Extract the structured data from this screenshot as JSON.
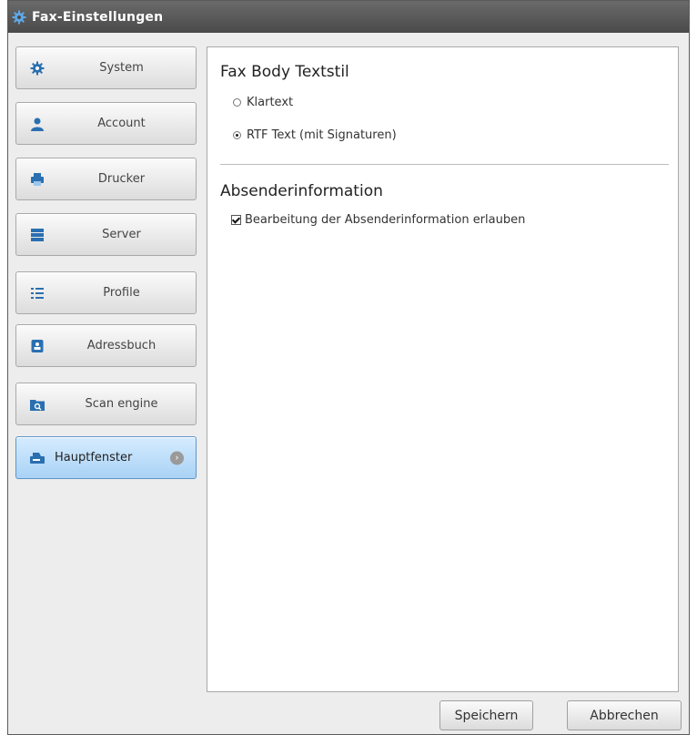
{
  "window": {
    "title": "Fax-Einstellungen"
  },
  "sidebar": {
    "items": [
      {
        "label": "System",
        "icon": "gear-icon"
      },
      {
        "label": "Account",
        "icon": "user-icon"
      },
      {
        "label": "Drucker",
        "icon": "printer-icon"
      },
      {
        "label": "Server",
        "icon": "server-icon"
      },
      {
        "label": "Profile",
        "icon": "list-icon"
      },
      {
        "label": "Adressbuch",
        "icon": "address-book-icon"
      },
      {
        "label": "Scan engine",
        "icon": "scan-folder-icon"
      },
      {
        "label": "Hauptfenster",
        "icon": "fax-machine-icon",
        "active": true
      }
    ]
  },
  "content": {
    "fax_body_title": "Fax Body Textstil",
    "radio_plain": "Klartext",
    "radio_rtf": "RTF Text (mit Signaturen)",
    "radio_selected": "RTF Text (mit Signaturen)",
    "sender_title": "Absenderinformation",
    "checkbox_edit_sender": "Bearbeitung der Absenderinformation erlauben",
    "checkbox_edit_sender_checked": true
  },
  "footer": {
    "save_label": "Speichern",
    "cancel_label": "Abbrechen"
  },
  "colors": {
    "title_bar": "#555555",
    "active_nav": "#b7dbf8",
    "accent_icon": "#2a6fb0"
  }
}
